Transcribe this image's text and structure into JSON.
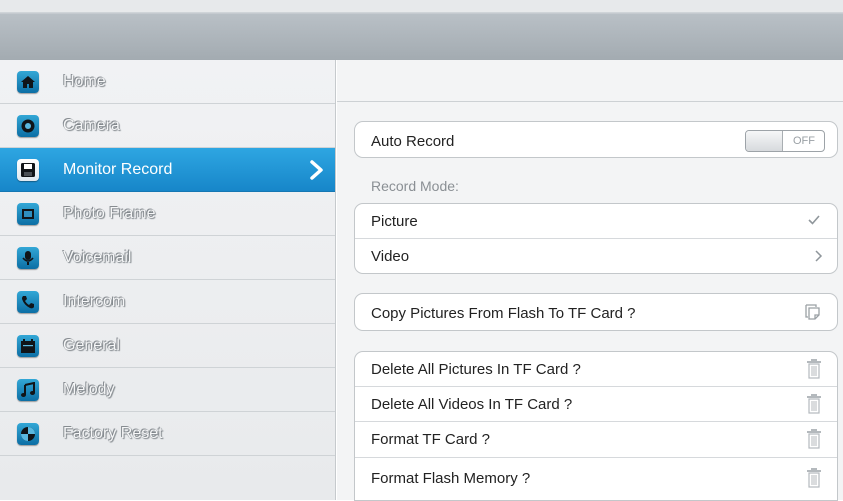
{
  "sidebar": {
    "items": [
      {
        "label": "Home",
        "icon": "home-icon"
      },
      {
        "label": "Camera",
        "icon": "camera-icon"
      },
      {
        "label": "Monitor Record",
        "icon": "floppy-disk-icon",
        "active": true
      },
      {
        "label": "Photo Frame",
        "icon": "photo-frame-icon"
      },
      {
        "label": "Voicemail",
        "icon": "microphone-icon"
      },
      {
        "label": "Intercom",
        "icon": "phone-icon"
      },
      {
        "label": "General",
        "icon": "calendar-icon"
      },
      {
        "label": "Melody",
        "icon": "music-note-icon"
      },
      {
        "label": "Factory Reset",
        "icon": "reset-icon"
      }
    ]
  },
  "main": {
    "auto_record": {
      "label": "Auto Record",
      "toggle_state": "OFF"
    },
    "record_mode_label": "Record Mode:",
    "record_mode_options": [
      {
        "label": "Picture",
        "indicator": "checkmark-icon"
      },
      {
        "label": "Video",
        "indicator": "chevron-right-icon"
      }
    ],
    "copy_row": {
      "label": "Copy Pictures From Flash To TF Card ?"
    },
    "delete_rows": [
      {
        "label": "Delete All Pictures In TF Card ?"
      },
      {
        "label": "Delete All Videos In TF Card ?"
      },
      {
        "label": "Format TF Card ?"
      },
      {
        "label": "Format Flash Memory ?"
      }
    ]
  },
  "colors": {
    "active_item": "#1f95d6",
    "topbar": "#a9b0b6"
  }
}
